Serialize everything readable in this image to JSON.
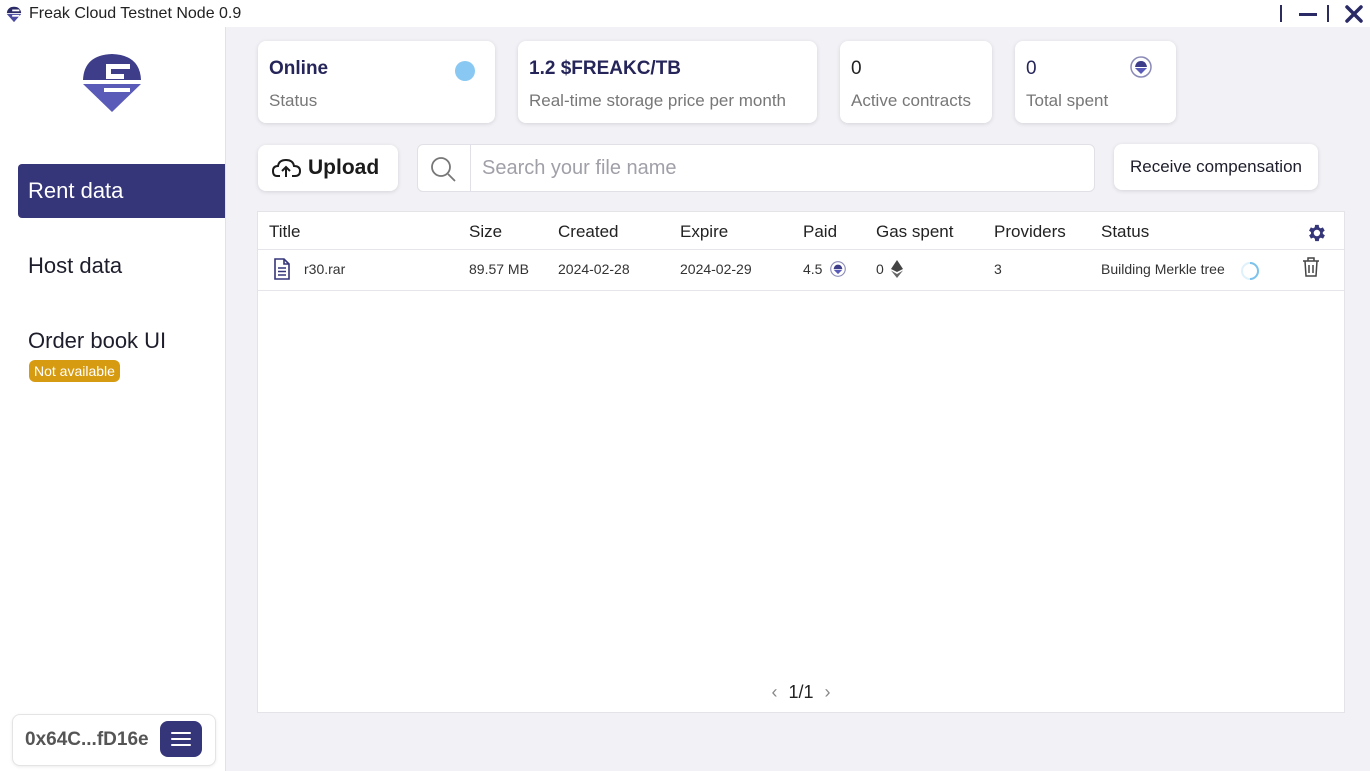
{
  "window": {
    "title": "Freak Cloud Testnet Node 0.9"
  },
  "sidebar": {
    "items": [
      {
        "label": "Rent data",
        "active": true
      },
      {
        "label": "Host data",
        "active": false
      },
      {
        "label": "Order book UI",
        "active": false
      }
    ],
    "order_book_badge": "Not available",
    "wallet_address": "0x64C...fD16e"
  },
  "stats": {
    "status": {
      "value": "Online",
      "label": "Status",
      "color": "#88c8f2"
    },
    "price": {
      "value": "1.2 $FREAKC/TB",
      "label": "Real-time storage price per month"
    },
    "contracts": {
      "value": "0",
      "label": "Active contracts"
    },
    "spent": {
      "value": "0",
      "label": "Total spent"
    }
  },
  "toolbar": {
    "upload_label": "Upload",
    "search_placeholder": "Search your file name",
    "receive_label": "Receive compensation"
  },
  "table": {
    "headers": [
      "Title",
      "Size",
      "Created",
      "Expire",
      "Paid",
      "Gas spent",
      "Providers",
      "Status"
    ],
    "rows": [
      {
        "title": "r30.rar",
        "size": "89.57 MB",
        "created": "2024-02-28",
        "expire": "2024-02-29",
        "paid": "4.5",
        "gas": "0",
        "providers": "3",
        "status": "Building Merkle tree"
      }
    ]
  },
  "pagination": {
    "text": "1/1"
  },
  "colors": {
    "accent": "#35357a",
    "badge": "#d79b12",
    "background": "#f1f1f6"
  }
}
